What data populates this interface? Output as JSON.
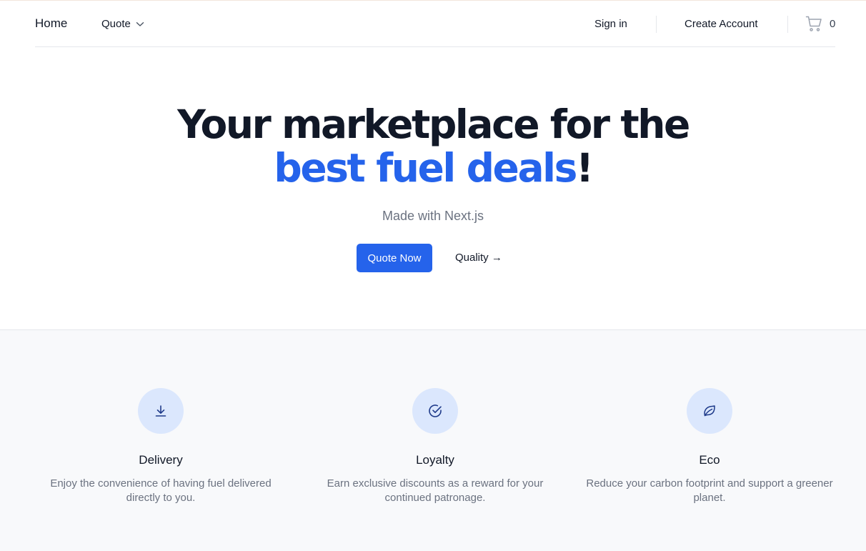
{
  "nav": {
    "home": "Home",
    "quote": "Quote",
    "sign_in": "Sign in",
    "create_account": "Create Account",
    "cart_count": "0"
  },
  "hero": {
    "title_line1": "Your marketplace for the",
    "title_accent": "best fuel deals",
    "title_end": "!",
    "subtitle": "Made with Next.js",
    "primary_button": "Quote Now",
    "secondary_link": "Quality →"
  },
  "features": [
    {
      "icon": "download-icon",
      "title": "Delivery",
      "description": "Enjoy the convenience of having fuel delivered directly to you."
    },
    {
      "icon": "check-circle-icon",
      "title": "Loyalty",
      "description": "Earn exclusive discounts as a reward for your continued patronage."
    },
    {
      "icon": "leaf-icon",
      "title": "Eco",
      "description": "Reduce your carbon footprint and support a greener planet."
    }
  ],
  "colors": {
    "accent": "#2563eb",
    "text": "#111827",
    "muted": "#6b7280",
    "icon_bg": "#dbe7fd",
    "section_bg": "#f8f9fb"
  }
}
